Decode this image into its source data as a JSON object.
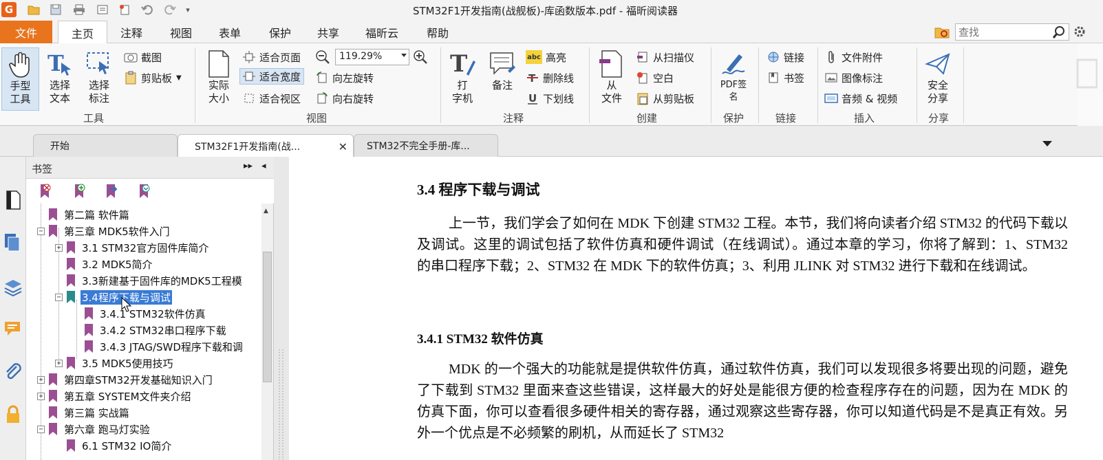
{
  "window": {
    "title": "STM32F1开发指南(战舰板)-库函数版本.pdf - 福昕阅读器"
  },
  "menu": {
    "file": "文件",
    "tabs": [
      "主页",
      "注释",
      "视图",
      "表单",
      "保护",
      "共享",
      "福昕云",
      "帮助"
    ],
    "active_tab": "主页",
    "search": {
      "placeholder": "查找"
    }
  },
  "ribbon": {
    "tools": {
      "label": "工具",
      "hand": "手型\n工具",
      "select_text": "选择\n文本",
      "select_annot": "选择\n标注",
      "screenshot": "截图",
      "clipboard": "剪贴板"
    },
    "view": {
      "label": "视图",
      "actual_size": "实际\n大小",
      "fit_page": "适合页面",
      "fit_width": "适合宽度",
      "fit_visible": "适合视区",
      "zoom": "119.29%",
      "rotate_left": "向左旋转",
      "rotate_right": "向右旋转"
    },
    "annot": {
      "label": "注释",
      "typewriter": "打\n字机",
      "note": "备注",
      "highlight": "高亮",
      "strikeout": "删除线",
      "underline": "下划线",
      "highlight_icon_text": "abc"
    },
    "create": {
      "label": "创建",
      "from_file": "从\n文件",
      "from_scanner": "从扫描仪",
      "blank": "空白",
      "from_clipboard": "从剪贴板"
    },
    "protect": {
      "label": "保护",
      "pdf_sign": "PDF签\n名"
    },
    "links": {
      "label": "链接",
      "link": "链接",
      "bookmark": "书签"
    },
    "insert": {
      "label": "插入",
      "file_attach": "文件附件",
      "image_annot": "图像标注",
      "audio_video": "音频 & 视频"
    },
    "share": {
      "label": "分享",
      "secure_share": "安全\n分享"
    }
  },
  "doc_tabs": [
    {
      "label": "开始"
    },
    {
      "label": "STM32F1开发指南(战..."
    },
    {
      "label": "STM32不完全手册-库..."
    }
  ],
  "bookmarks": {
    "title": "书签",
    "items": [
      "第二篇 软件篇",
      "第三章 MDK5软件入门",
      "3.1 STM32官方固件库简介",
      "3.2 MDK5简介",
      "3.3新建基于固件库的MDK5工程模",
      "3.4程序下载与调试",
      "3.4.1 STM32软件仿真",
      "3.4.2 STM32串口程序下载",
      "3.4.3 JTAG/SWD程序下载和调",
      "3.5 MDK5使用技巧",
      "第四章STM32开发基础知识入门",
      "第五章 SYSTEM文件夹介绍",
      "第三篇 实战篇",
      "第六章 跑马灯实验",
      "6.1 STM32 IO简介"
    ]
  },
  "document": {
    "heading": "3.4 程序下载与调试",
    "para1": "上一节，我们学会了如何在 MDK 下创建 STM32 工程。本节，我们将向读者介绍 STM32 的代码下载以及调试。这里的调试包括了软件仿真和硬件调试（在线调试）。通过本章的学习，你将了解到：1、STM32 的串口程序下载；2、STM32 在 MDK 下的软件仿真；3、利用 JLINK 对 STM32 进行下载和在线调试。",
    "subheading": "3.4.1 STM32 软件仿真",
    "para2": "MDK 的一个强大的功能就是提供软件仿真，通过软件仿真，我们可以发现很多将要出现的问题，避免了下载到 STM32 里面来查这些错误，这样最大的好处是能很方便的检查程序存在的问题，因为在 MDK 的仿真下面，你可以查看很多硬件相关的寄存器，通过观察这些寄存器，你可以知道代码是不是真正有效。另外一个优点是不必频繁的刷机，从而延长了 STM32"
  },
  "colors": {
    "accent": "#e8741e",
    "selection": "#3a7bd5",
    "bookmark": "#9b4f92",
    "bookmark_sel": "#2a8b8b"
  }
}
